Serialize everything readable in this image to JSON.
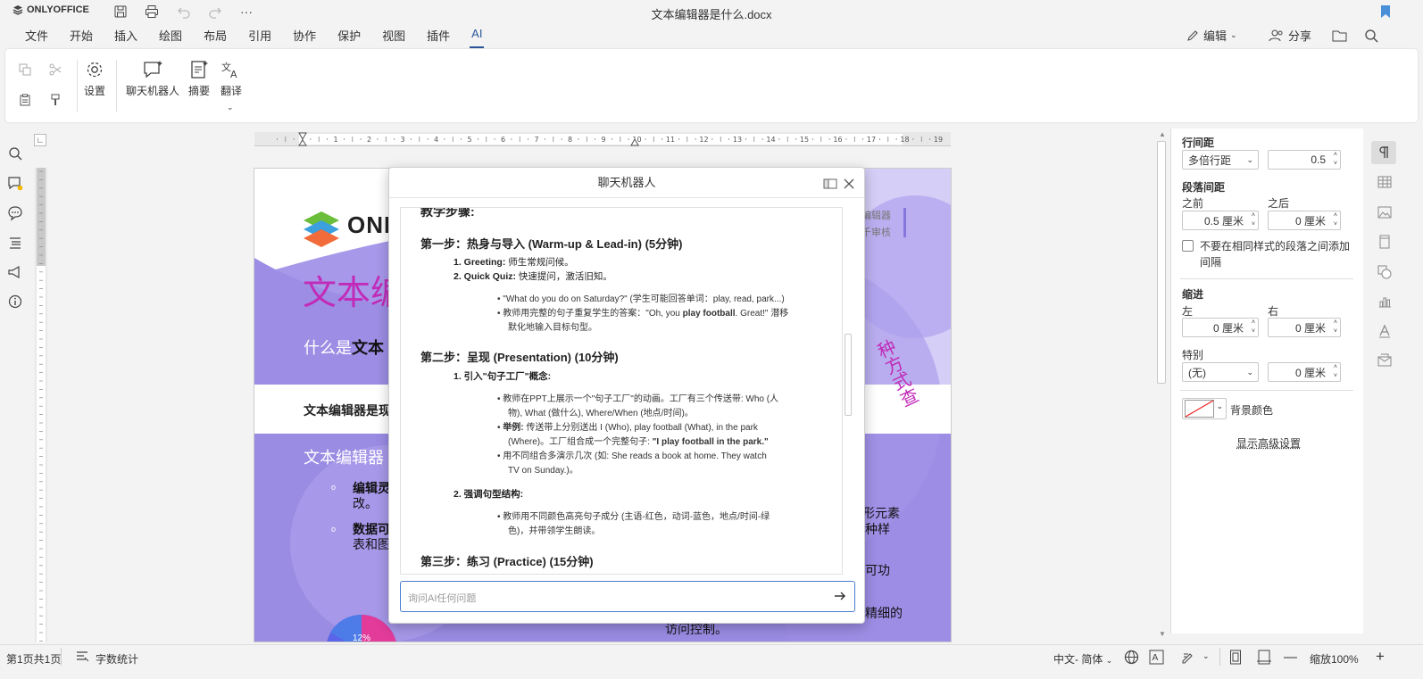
{
  "app": {
    "logo": "ONLYOFFICE",
    "doc_title": "文本编辑器是什么.docx"
  },
  "quick": {
    "more": "···"
  },
  "tabs": [
    {
      "label": "文件"
    },
    {
      "label": "开始"
    },
    {
      "label": "插入"
    },
    {
      "label": "绘图"
    },
    {
      "label": "布局"
    },
    {
      "label": "引用"
    },
    {
      "label": "协作"
    },
    {
      "label": "保护"
    },
    {
      "label": "视图"
    },
    {
      "label": "插件"
    },
    {
      "label": "AI"
    }
  ],
  "header_right": {
    "edit_label": "编辑",
    "share_label": "分享"
  },
  "toolbar": {
    "settings": "设置",
    "chatbot": "聊天机器人",
    "summary": "摘要",
    "translate": "翻译"
  },
  "ruler": {
    "numbers": [
      "1",
      "1",
      "2",
      "3",
      "4",
      "5",
      "6",
      "7",
      "8",
      "9",
      "10",
      "11",
      "12",
      "13",
      "14",
      "15",
      "16",
      "17",
      "18",
      "19"
    ]
  },
  "page": {
    "logo_text": "ONL",
    "right_text_1": "编辑器",
    "right_text_2": "千审核",
    "big_title": "文本编",
    "subtitle_prefix": "什么是",
    "subtitle_bold": "文本",
    "intro": "文本编辑器是现",
    "section": "文本编辑器",
    "bullet1_bold": "编辑灵",
    "bullet1_rest": "改。",
    "bullet2_bold": "数据可",
    "bullet2_rest": "表和图",
    "right_frag_1": "形元素",
    "right_frag_2": "种样",
    "right_frag_3": "可功",
    "right_frag_4": "精细的",
    "right_frag_5": "访问控制。",
    "vertical_text": "种方式查",
    "pie_label": "12%"
  },
  "chat": {
    "title": "聊天机器人",
    "heading_cut": "教学步骤:",
    "step1": "第一步：热身与导入 (Warm-up & Lead-in) (5分钟)",
    "s1_item1_bold": "1. Greeting:",
    "s1_item1_rest": " 师生常规问候。",
    "s1_item2_bold": "2. Quick Quiz:",
    "s1_item2_rest": " 快速提问，激活旧知。",
    "s1_b1": "\"What do you do on Saturday?\" (学生可能回答单词：play, read, park...)",
    "s1_b2a": "教师用完整的句子重复学生的答案：\"Oh, you ",
    "s1_b2_bold": "play football",
    "s1_b2b": ". Great!\" 潜移",
    "s1_b2c": "默化地输入目标句型。",
    "step2": "第二步：呈现 (Presentation) (10分钟)",
    "s2_item1": "1. 引入\"句子工厂\"概念:",
    "s2_b1a": "教师在PPT上展示一个\"句子工厂\"的动画。工厂有三个传送带: Who (人",
    "s2_b1b": "物), What (做什么), Where/When (地点/时间)。",
    "s2_b2_bold": "举例:",
    "s2_b2a": " 传送带上分别送出 I (Who), play football (What), in the park",
    "s2_b2b": "(Where)。工厂组合成一个完整句子: ",
    "s2_b2_quote": "\"I play football in the park.\"",
    "s2_b3a": "用不同组合多演示几次 (如: She reads a book at home. They watch",
    "s2_b3b": "TV on Sunday.)。",
    "s2_item2": "2. 强调句型结构:",
    "s2_b4a": "教师用不同颜色高亮句子成分 (主语-红色，动词-蓝色，地点/时间-绿",
    "s2_b4b": "色)，并带领学生朗读。",
    "step3": "第三步：练习 (Practice) (15分钟)",
    "input_placeholder": "询问AI任何问题"
  },
  "rpanel": {
    "line_spacing": "行间距",
    "line_mode": "多倍行距",
    "line_value": "0.5",
    "para_spacing": "段落间距",
    "before": "之前",
    "after": "之后",
    "before_value": "0.5 厘米",
    "after_value": "0 厘米",
    "no_space_label": "不要在相同样式的段落之间添加间隔",
    "indent": "缩进",
    "left": "左",
    "right": "右",
    "left_value": "0 厘米",
    "right_value": "0 厘米",
    "special": "特别",
    "special_mode": "(无)",
    "special_value": "0 厘米",
    "bg_color": "背景颜色",
    "advanced": "显示高级设置"
  },
  "status": {
    "page_info": "第1页共1页",
    "word_count": "字数统计",
    "language": "中文- 简体",
    "zoom": "缩放100%"
  },
  "colors": {
    "accent": "#2b579a",
    "purple": "#8e7fe0",
    "magenta": "#c12bb8"
  }
}
